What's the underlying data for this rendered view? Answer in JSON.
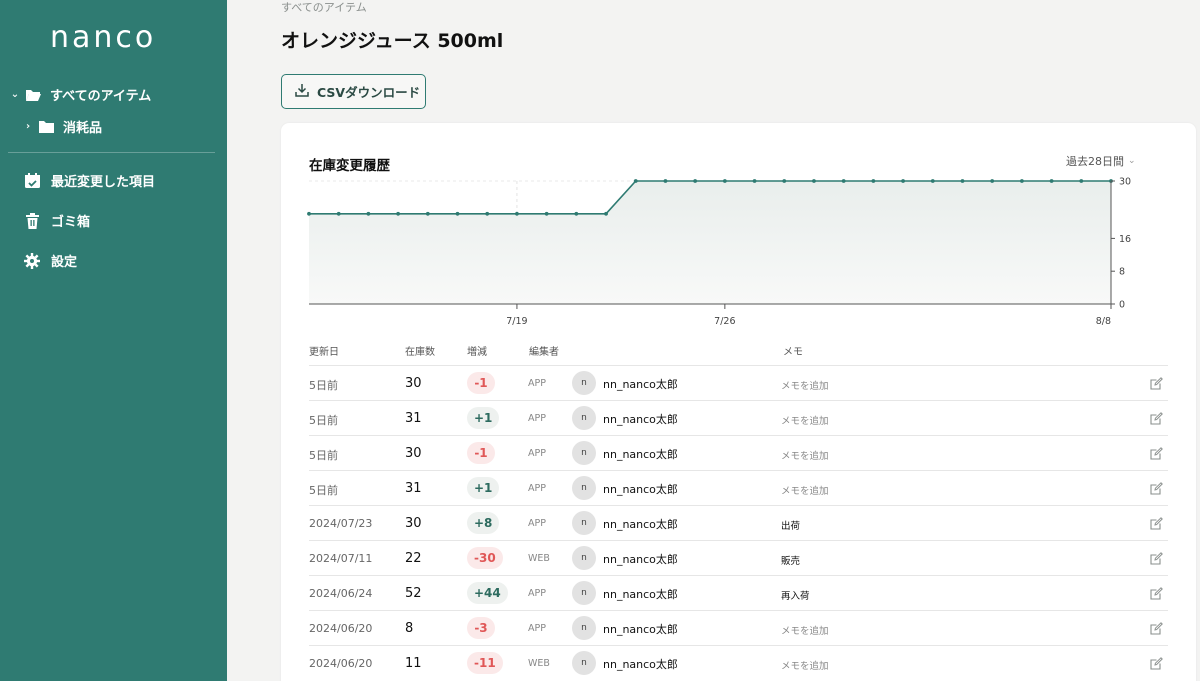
{
  "sidebar": {
    "logo": "nanco",
    "all_items_label": "すべてのアイテム",
    "consumables_label": "消耗品",
    "recent_label": "最近変更した項目",
    "trash_label": "ゴミ箱",
    "settings_label": "設定"
  },
  "header": {
    "breadcrumb": "すべてのアイテム",
    "title": "オレンジジュース 500ml",
    "csv_button": "CSVダウンロード"
  },
  "history": {
    "title": "在庫変更履歴",
    "period": "過去28日間"
  },
  "chart_data": {
    "type": "line",
    "x_tick_labels": [
      "7/19",
      "7/26",
      "8/8"
    ],
    "y_tick_labels": [
      "30",
      "16",
      "8",
      "0"
    ],
    "ylim": [
      0,
      30
    ],
    "series": [
      {
        "values": [
          22,
          22,
          22,
          22,
          22,
          22,
          22,
          22,
          22,
          22,
          22,
          30,
          30,
          30,
          30,
          30,
          30,
          30,
          30,
          30,
          30,
          30,
          30,
          30,
          30,
          30,
          30,
          30
        ]
      }
    ],
    "grid": true,
    "line_color": "#2f7b72"
  },
  "table": {
    "headers": {
      "date": "更新日",
      "stock": "在庫数",
      "delta": "増減",
      "editor": "編集者",
      "memo": "メモ"
    },
    "rows": [
      {
        "date": "5日前",
        "stock": "30",
        "delta": "-1",
        "sign": "neg",
        "source": "APP",
        "avatar": "n",
        "editor": "nn_nanco太郎",
        "memo": "メモを追加",
        "memo_filled": false
      },
      {
        "date": "5日前",
        "stock": "31",
        "delta": "+1",
        "sign": "pos",
        "source": "APP",
        "avatar": "n",
        "editor": "nn_nanco太郎",
        "memo": "メモを追加",
        "memo_filled": false
      },
      {
        "date": "5日前",
        "stock": "30",
        "delta": "-1",
        "sign": "neg",
        "source": "APP",
        "avatar": "n",
        "editor": "nn_nanco太郎",
        "memo": "メモを追加",
        "memo_filled": false
      },
      {
        "date": "5日前",
        "stock": "31",
        "delta": "+1",
        "sign": "pos",
        "source": "APP",
        "avatar": "n",
        "editor": "nn_nanco太郎",
        "memo": "メモを追加",
        "memo_filled": false
      },
      {
        "date": "2024/07/23",
        "stock": "30",
        "delta": "+8",
        "sign": "pos",
        "source": "APP",
        "avatar": "n",
        "editor": "nn_nanco太郎",
        "memo": "出荷",
        "memo_filled": true
      },
      {
        "date": "2024/07/11",
        "stock": "22",
        "delta": "-30",
        "sign": "neg",
        "source": "WEB",
        "avatar": "n",
        "editor": "nn_nanco太郎",
        "memo": "販売",
        "memo_filled": true
      },
      {
        "date": "2024/06/24",
        "stock": "52",
        "delta": "+44",
        "sign": "pos",
        "source": "APP",
        "avatar": "n",
        "editor": "nn_nanco太郎",
        "memo": "再入荷",
        "memo_filled": true
      },
      {
        "date": "2024/06/20",
        "stock": "8",
        "delta": "-3",
        "sign": "neg",
        "source": "APP",
        "avatar": "n",
        "editor": "nn_nanco太郎",
        "memo": "メモを追加",
        "memo_filled": false
      },
      {
        "date": "2024/06/20",
        "stock": "11",
        "delta": "-11",
        "sign": "neg",
        "source": "WEB",
        "avatar": "n",
        "editor": "nn_nanco太郎",
        "memo": "メモを追加",
        "memo_filled": false
      }
    ]
  },
  "colors": {
    "sidebar": "#2f7b72",
    "accent": "#2f7b72",
    "negative": "#e05757",
    "positive": "#2d6b5f"
  }
}
